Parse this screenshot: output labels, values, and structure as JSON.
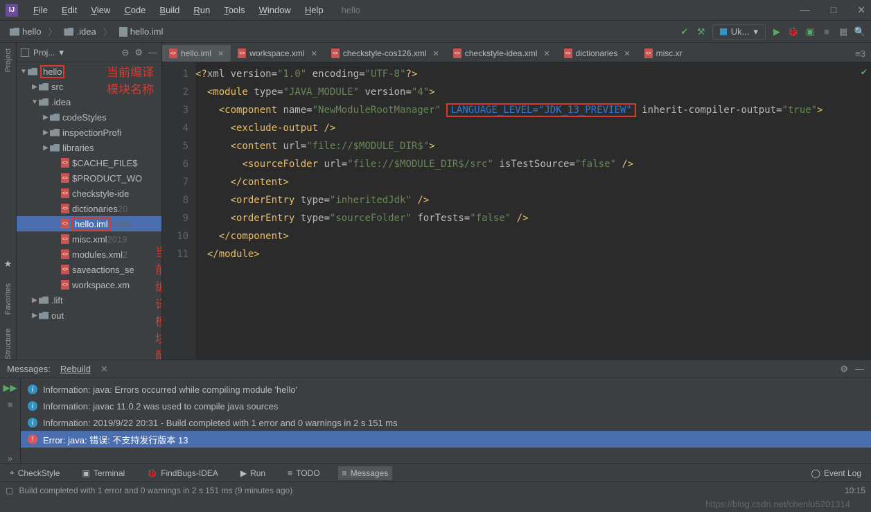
{
  "app_name": "hello",
  "menu": [
    "File",
    "Edit",
    "View",
    "Code",
    "Build",
    "Run",
    "Tools",
    "Window",
    "Help"
  ],
  "window_controls": {
    "min": "—",
    "max": "□",
    "close": "✕"
  },
  "breadcrumb": [
    {
      "icon": "folder",
      "label": "hello"
    },
    {
      "icon": "folder",
      "label": ".idea"
    },
    {
      "icon": "file",
      "label": "hello.iml"
    }
  ],
  "run_config_label": "Uk...",
  "toolbar_icons": [
    "hammer",
    "run-config",
    "play",
    "debug",
    "coverage",
    "stop",
    "panes",
    "search"
  ],
  "project_panel": {
    "title": "Proj...",
    "header_icons": [
      "collapse",
      "gear",
      "hide"
    ],
    "tree": [
      {
        "d": 0,
        "arrow": "▼",
        "icon": "folder",
        "label": "hello",
        "hl": true
      },
      {
        "d": 1,
        "arrow": "▶",
        "icon": "folder",
        "label": "src"
      },
      {
        "d": 1,
        "arrow": "▼",
        "icon": "folder",
        "label": ".idea"
      },
      {
        "d": 2,
        "arrow": "▶",
        "icon": "folder",
        "label": "codeStyles"
      },
      {
        "d": 2,
        "arrow": "▶",
        "icon": "folder",
        "label": "inspectionProfi"
      },
      {
        "d": 2,
        "arrow": "▶",
        "icon": "folder",
        "label": "libraries"
      },
      {
        "d": 3,
        "arrow": "",
        "icon": "xml",
        "label": "$CACHE_FILE$"
      },
      {
        "d": 3,
        "arrow": "",
        "icon": "xml",
        "label": "$PRODUCT_WO"
      },
      {
        "d": 3,
        "arrow": "",
        "icon": "xml",
        "label": "checkstyle-ide"
      },
      {
        "d": 3,
        "arrow": "",
        "icon": "xml",
        "label": "dictionaries",
        "tail": "20"
      },
      {
        "d": 3,
        "arrow": "",
        "icon": "xml",
        "label": "hello.iml",
        "hl": true,
        "sel": true,
        "tail": "2019"
      },
      {
        "d": 3,
        "arrow": "",
        "icon": "xml",
        "label": "misc.xml",
        "tail": "2019"
      },
      {
        "d": 3,
        "arrow": "",
        "icon": "xml",
        "label": "modules.xml",
        "tail": "2"
      },
      {
        "d": 3,
        "arrow": "",
        "icon": "xml",
        "label": "saveactions_se"
      },
      {
        "d": 3,
        "arrow": "",
        "icon": "xml",
        "label": "workspace.xm"
      },
      {
        "d": 1,
        "arrow": "▶",
        "icon": "folder",
        "label": ".lift"
      },
      {
        "d": 1,
        "arrow": "▶",
        "icon": "folder",
        "label": "out"
      }
    ]
  },
  "annotations": {
    "a1": "当前编译模块名称",
    "a2": "当前编译模块配置文件"
  },
  "tabs": [
    {
      "icon": "xml",
      "label": "hello.iml",
      "active": true,
      "close": true
    },
    {
      "icon": "xml",
      "label": "workspace.xml",
      "close": true
    },
    {
      "icon": "xml",
      "label": "checkstyle-cos126.xml",
      "close": true
    },
    {
      "icon": "xml",
      "label": "checkstyle-idea.xml",
      "close": true
    },
    {
      "icon": "xml",
      "label": "dictionaries",
      "close": true
    },
    {
      "icon": "xml",
      "label": "misc.xr"
    }
  ],
  "breadcrumb_indicator": "≡3",
  "code": {
    "lines": [
      1,
      2,
      3,
      4,
      5,
      6,
      7,
      8,
      9,
      10,
      11
    ],
    "content": [
      {
        "t": "xml-decl",
        "text": "<?xml version=\"1.0\" encoding=\"UTF-8\"?>"
      },
      {
        "t": "open",
        "tag": "module",
        "attrs": [
          [
            "type",
            "JAVA_MODULE"
          ],
          [
            "version",
            "4"
          ]
        ]
      },
      {
        "t": "open",
        "tag": "component",
        "attrs": [
          [
            "name",
            "NewModuleRootManager"
          ]
        ],
        "hl": [
          [
            "LANGUAGE_LEVEL",
            "JDK_13_PREVIEW"
          ]
        ],
        "tail": [
          [
            "inherit-compiler-output",
            "true"
          ]
        ]
      },
      {
        "t": "selfclose",
        "tag": "exclude-output",
        "indent": 3
      },
      {
        "t": "open",
        "tag": "content",
        "attrs": [
          [
            "url",
            "file://$MODULE_DIR$"
          ]
        ],
        "indent": 3
      },
      {
        "t": "selfclose",
        "tag": "sourceFolder",
        "attrs": [
          [
            "url",
            "file://$MODULE_DIR$/src"
          ],
          [
            "isTestSource",
            "false"
          ]
        ],
        "indent": 4
      },
      {
        "t": "close",
        "tag": "content",
        "indent": 3
      },
      {
        "t": "selfclose",
        "tag": "orderEntry",
        "attrs": [
          [
            "type",
            "inheritedJdk"
          ]
        ],
        "indent": 3
      },
      {
        "t": "selfclose",
        "tag": "orderEntry",
        "attrs": [
          [
            "type",
            "sourceFolder"
          ],
          [
            "forTests",
            "false"
          ]
        ],
        "indent": 3
      },
      {
        "t": "close",
        "tag": "component",
        "indent": 2
      },
      {
        "t": "close",
        "tag": "module",
        "indent": 1
      }
    ]
  },
  "messages": {
    "header": "Messages:",
    "tab": "Rebuild",
    "rows": [
      {
        "type": "info",
        "text": "Information: java: Errors occurred while compiling module 'hello'"
      },
      {
        "type": "info",
        "text": "Information: javac 11.0.2 was used to compile java sources"
      },
      {
        "type": "info",
        "text": "Information: 2019/9/22 20:31 - Build completed with 1 error and 0 warnings in 2 s 151 ms"
      },
      {
        "type": "error",
        "text": "Error: java: 错误: 不支持发行版本 13",
        "sel": true
      }
    ]
  },
  "bottom_tabs": [
    {
      "icon": "checkstyle",
      "label": "CheckStyle"
    },
    {
      "icon": "terminal",
      "label": "Terminal"
    },
    {
      "icon": "findbugs",
      "label": "FindBugs-IDEA"
    },
    {
      "icon": "run",
      "label": "Run"
    },
    {
      "icon": "todo",
      "label": "TODO"
    },
    {
      "icon": "messages",
      "label": "Messages",
      "active": true
    }
  ],
  "event_log": "Event Log",
  "status": {
    "left": "Build completed with 1 error and 0 warnings in 2 s 151 ms (9 minutes ago)",
    "right": [
      "10:15"
    ]
  },
  "watermark": "https://blog.csdn.net/chenlu5201314",
  "rails": {
    "left": [
      "Project",
      "Favorites",
      "Structure"
    ]
  }
}
